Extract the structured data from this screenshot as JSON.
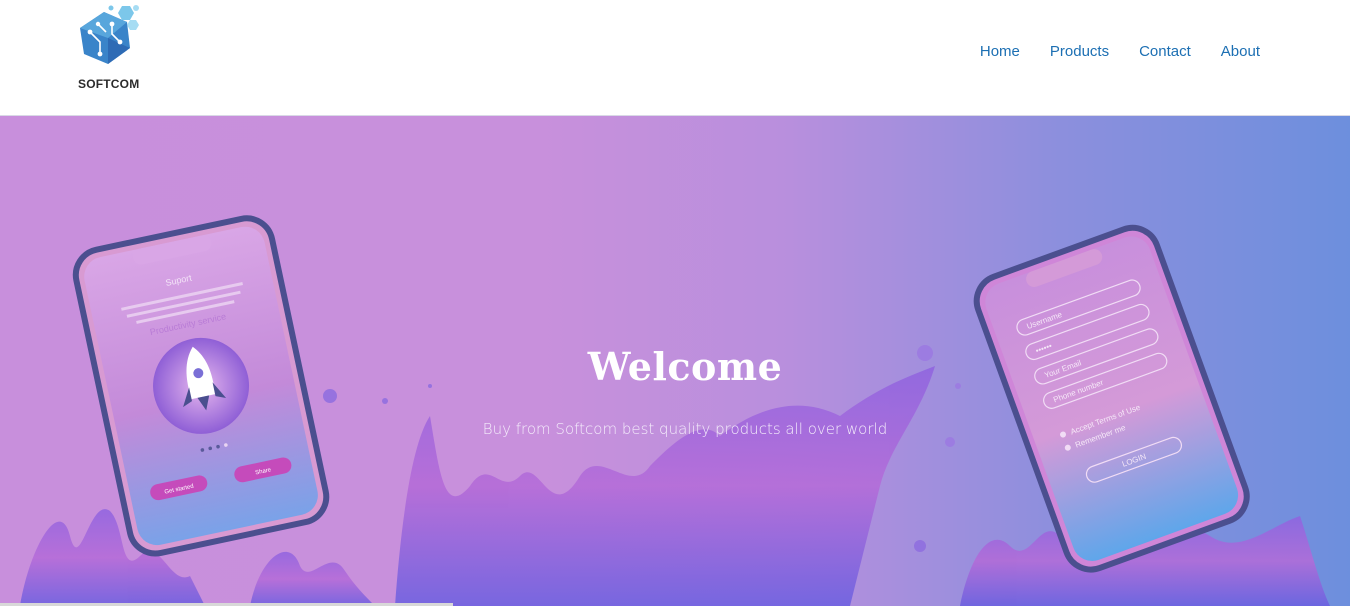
{
  "brand": {
    "name": "SOFTCOM",
    "logo_icon": "hexagon-circuit-icon"
  },
  "nav": {
    "items": [
      {
        "label": "Home"
      },
      {
        "label": "Products"
      },
      {
        "label": "Contact"
      },
      {
        "label": "About"
      }
    ]
  },
  "hero": {
    "title": "Welcome",
    "subtitle": "Buy from Softcom best quality products all over world",
    "left_phone": {
      "heading": "Suport",
      "service_label": "Productivity service",
      "buttons": [
        "Get started",
        "Share"
      ]
    },
    "right_phone": {
      "fields": [
        "Username",
        "••••••",
        "Your Email",
        "Phone number"
      ],
      "checks": [
        "Accept Terms of Use",
        "Remember me"
      ],
      "button": "LOGIN"
    }
  },
  "colors": {
    "nav_link": "#1c6fb3",
    "hero_start": "#c88fdc",
    "hero_end": "#6d8fdd"
  }
}
